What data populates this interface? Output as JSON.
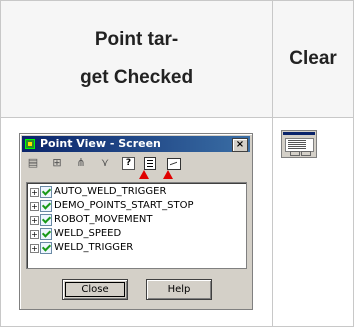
{
  "table": {
    "header_col1_line1": "Point tar-",
    "header_col1_line2": "get Checked",
    "header_col2": "Clear"
  },
  "dialog": {
    "title": "Point View - Screen",
    "close_glyph": "×",
    "help_glyph": "?",
    "tree_items": [
      {
        "label": "AUTO_WELD_TRIGGER",
        "checked": true
      },
      {
        "label": "DEMO_POINTS_START_STOP",
        "checked": true
      },
      {
        "label": "ROBOT_MOVEMENT",
        "checked": true
      },
      {
        "label": "WELD_SPEED",
        "checked": true
      },
      {
        "label": "WELD_TRIGGER",
        "checked": true
      }
    ],
    "expander_glyph": "+",
    "buttons": {
      "close": "Close",
      "help": "Help"
    }
  },
  "colors": {
    "title_bar": "#0a246a",
    "highlight_arrow": "#e00000",
    "checkmark": "#1a9a1a"
  }
}
